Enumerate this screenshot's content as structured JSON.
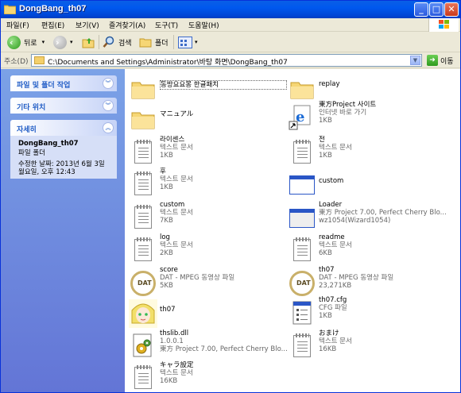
{
  "window": {
    "title": "DongBang_th07",
    "minimize": "_",
    "maximize": "□",
    "close": "✕"
  },
  "menu": [
    "파일(F)",
    "편집(E)",
    "보기(V)",
    "즐겨찾기(A)",
    "도구(T)",
    "도움말(H)"
  ],
  "toolbar": {
    "back": "뒤로",
    "search": "검색",
    "folders": "폴더"
  },
  "address": {
    "label": "주소(D)",
    "path": "C:\\Documents and Settings\\Administrator\\바탕 화면\\DongBang_th07",
    "go": "이동"
  },
  "sidebar": {
    "panels": [
      {
        "title": "파일 및 폴더 작업"
      },
      {
        "title": "기타 위치"
      },
      {
        "title": "자세히"
      }
    ],
    "details": {
      "name": "DongBang_th07",
      "type": "파일 폴더",
      "modified_label": "수정한 날짜: 2013년 6월 3일",
      "modified_time": "월요일, 오후 12:43"
    }
  },
  "files": [
    {
      "name": "동방요요몽 한글패치",
      "lines": [],
      "icon": "folder-icon"
    },
    {
      "name": "replay",
      "lines": [],
      "icon": "folder-icon"
    },
    {
      "name": "マニュアル",
      "lines": [],
      "icon": "folder-icon"
    },
    {
      "name": "東方Project 사이트",
      "lines": [
        "인터넷 바로 가기",
        "1KB"
      ],
      "icon": "internet-shortcut-icon"
    },
    {
      "name": "라이센스",
      "lines": [
        "텍스트 문서",
        "1KB"
      ],
      "icon": "text-document-icon"
    },
    {
      "name": "전",
      "lines": [
        "텍스트 문서",
        "1KB"
      ],
      "icon": "text-document-icon"
    },
    {
      "name": "후",
      "lines": [
        "텍스트 문서",
        "1KB"
      ],
      "icon": "text-document-icon"
    },
    {
      "name": "custom",
      "lines": [],
      "icon": "application-window-icon"
    },
    {
      "name": "custom",
      "lines": [
        "텍스트 문서",
        "7KB"
      ],
      "icon": "text-document-icon"
    },
    {
      "name": "Loader",
      "lines": [
        "東方 Project 7.00, Perfect Cherry Blo...",
        "wz1054(Wizard1054)"
      ],
      "icon": "application-window-icon"
    },
    {
      "name": "log",
      "lines": [
        "텍스트 문서",
        "2KB"
      ],
      "icon": "text-document-icon"
    },
    {
      "name": "readme",
      "lines": [
        "텍스트 문서",
        "6KB"
      ],
      "icon": "text-document-icon"
    },
    {
      "name": "score",
      "lines": [
        "DAT - MPEG 동영상 파일",
        "5KB"
      ],
      "icon": "dat-file-icon"
    },
    {
      "name": "th07",
      "lines": [
        "DAT - MPEG 동영상 파일",
        "23,271KB"
      ],
      "icon": "dat-file-icon"
    },
    {
      "name": "th07",
      "lines": [],
      "icon": "game-character-icon"
    },
    {
      "name": "th07.cfg",
      "lines": [
        "CFG 파일",
        "1KB"
      ],
      "icon": "cfg-file-icon"
    },
    {
      "name": "thslib.dll",
      "lines": [
        "1.0.0.1",
        "東方 Project 7.00, Perfect Cherry Blo..."
      ],
      "icon": "dll-gear-icon"
    },
    {
      "name": "おまけ",
      "lines": [
        "텍스트 문서",
        "16KB"
      ],
      "icon": "text-document-icon"
    },
    {
      "name": "キャラ設定",
      "lines": [
        "텍스트 문서",
        "16KB"
      ],
      "icon": "text-document-icon"
    }
  ]
}
